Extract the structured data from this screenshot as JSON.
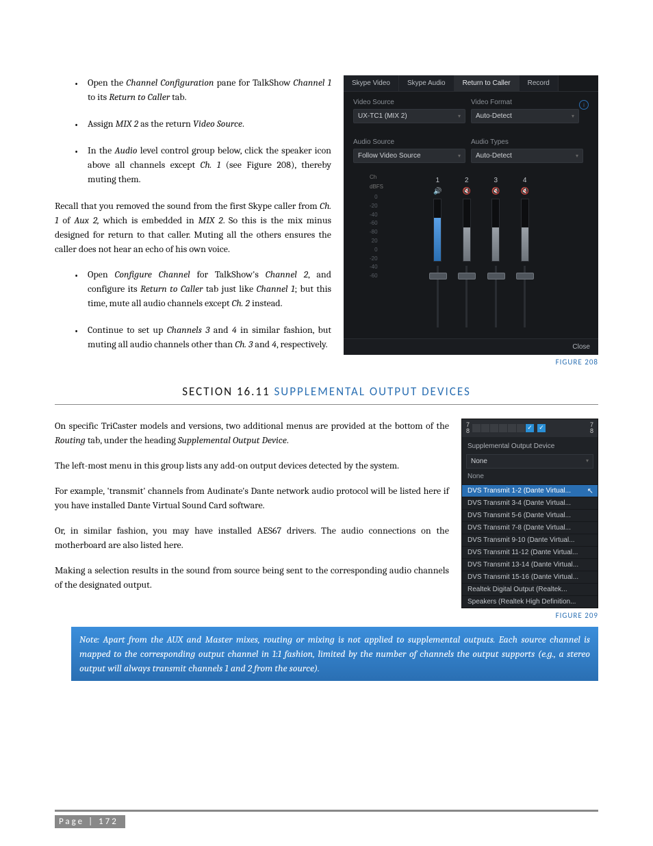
{
  "bullets1": [
    {
      "pre": "Open the ",
      "i1": "Channel Configuration",
      "mid": " pane for TalkShow ",
      "i2": "Channel 1",
      "mid2": " to its ",
      "i3": "Return to Caller",
      "post": " tab."
    },
    {
      "pre": "Assign ",
      "i1": "MIX 2",
      "mid": " as the return ",
      "i2": "Video Source",
      "post": "."
    },
    {
      "pre": "In the ",
      "i1": "Audio",
      "mid": " level control group below, click the speaker icon above all channels except ",
      "i2": "Ch. 1",
      "post": " (see Figure 208), thereby muting them."
    }
  ],
  "recall": {
    "t1": "Recall that you removed the sound from the first Skype caller from ",
    "i1": "Ch. 1",
    "t2": " of ",
    "i2": "Aux 2,",
    "t3": " which is embedded in ",
    "i3": "MIX 2",
    "t4": ".  So this is the mix minus designed for return to that caller. Muting all the others ensures the caller does not hear an echo of his own voice."
  },
  "bullets2": [
    {
      "pre": "Open ",
      "i1": "Configure Channel",
      "mid": " for TalkShow's ",
      "i2": "Channel 2",
      "mid2": ", and configure its ",
      "i3": "Return to Caller",
      "mid3": " tab just like ",
      "i4": "Channel 1",
      "post": "; but this time, mute all audio channels except ",
      "i5": "Ch. 2",
      "post2": " instead."
    },
    {
      "pre": "Continue to set up ",
      "i1": "Channels 3",
      "mid": " and ",
      "i2": "4",
      "mid2": " in similar fashion, but muting all audio channels other than ",
      "i3": "Ch. 3",
      "mid3": " and ",
      "i4": "4",
      "post": ", respectively."
    }
  ],
  "section": {
    "num": "SECTION 16.11 ",
    "title": "SUPPLEMENTAL OUTPUT DEVICES"
  },
  "p1": {
    "t1": "On specific TriCaster models and versions, two additional menus are provided at the bottom of the ",
    "i1": "Routing",
    "t2": " tab, under the heading ",
    "i2": "Supplemental Output Device",
    "t3": "."
  },
  "p2": "The left-most menu in this group lists any add-on output devices detected by the system.",
  "p3": "For example, 'transmit' channels from Audinate's Dante network audio protocol will be listed here if you have installed Dante Virtual Sound Card software.",
  "p4": "Or, in similar fashion, you may have installed AES67 drivers. The audio connections on the motherboard are also listed here.",
  "p5": "Making a selection results in the sound from source being sent to the corresponding audio channels of the designated output.",
  "note": "Note: Apart from the AUX and Master mixes, routing or mixing is not applied to supplemental outputs.  Each source channel is mapped to the corresponding output channel in 1:1 fashion, limited by the number of channels the output supports (e.g., a stereo output will always transmit channels 1 and 2 from the source).",
  "fig208": {
    "caption": "FIGURE 208",
    "tabs": [
      "Skype Video",
      "Skype Audio",
      "Return to Caller",
      "Record"
    ],
    "active_tab": 2,
    "video_source_label": "Video Source",
    "video_source_value": "UX-TC1 (MIX 2)",
    "video_format_label": "Video Format",
    "video_format_value": "Auto-Detect",
    "audio_source_label": "Audio Source",
    "audio_source_value": "Follow Video Source",
    "audio_types_label": "Audio Types",
    "audio_types_value": "Auto-Detect",
    "ch_label": "Ch",
    "dbfs_label": "dBFS",
    "scale": [
      "0",
      "-20",
      "-40",
      "-60",
      "-80",
      "20",
      "0",
      "-20",
      "-40",
      "-60"
    ],
    "channels": [
      {
        "num": "1",
        "muted": false,
        "meter": 70,
        "thumb": 10
      },
      {
        "num": "2",
        "muted": true,
        "meter": 55,
        "thumb": 10
      },
      {
        "num": "3",
        "muted": true,
        "meter": 55,
        "thumb": 10
      },
      {
        "num": "4",
        "muted": true,
        "meter": 55,
        "thumb": 10
      }
    ],
    "close": "Close"
  },
  "fig209": {
    "caption": "FIGURE 209",
    "top_left": "7\n8",
    "top_right": "7\n8",
    "heading": "Supplemental Output Device",
    "dropdown": "None",
    "none": "None",
    "items": [
      "DVS Transmit  1-2 (Dante Virtual...",
      "DVS Transmit  3-4 (Dante Virtual...",
      "DVS Transmit  5-6 (Dante Virtual...",
      "DVS Transmit  7-8 (Dante Virtual...",
      "DVS Transmit  9-10 (Dante Virtual...",
      "DVS Transmit 11-12 (Dante Virtual...",
      "DVS Transmit 13-14 (Dante Virtual...",
      "DVS Transmit 15-16 (Dante Virtual...",
      "Realtek Digital Output (Realtek...",
      "Speakers (Realtek High Definition..."
    ],
    "highlight": 0
  },
  "footer": {
    "page": "Page",
    "sep": " | ",
    "num": "172"
  }
}
